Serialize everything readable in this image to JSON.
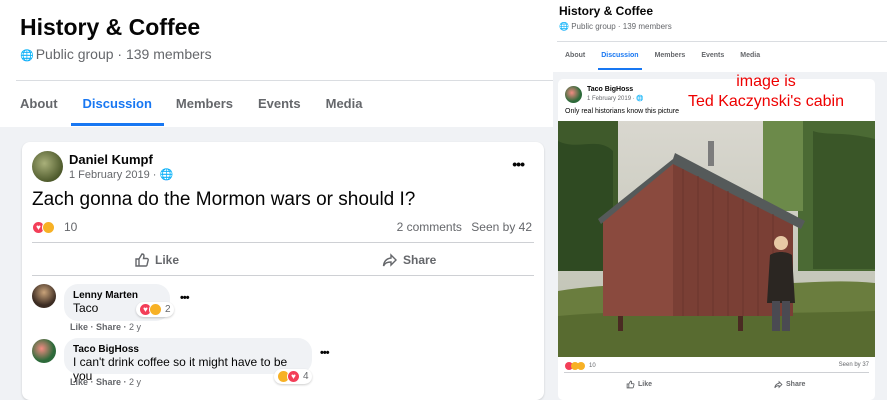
{
  "group": {
    "title": "History & Coffee",
    "meta": "Public group · 139 members",
    "tabs": [
      "About",
      "Discussion",
      "Members",
      "Events",
      "Media"
    ],
    "active_tab": "Discussion"
  },
  "post": {
    "author": "Daniel Kumpf",
    "date": "1 February 2019 · ",
    "text": "Zach gonna do the Mormon wars or should I?",
    "reaction_count": "10",
    "comments": "2 comments",
    "seen": "Seen by 42",
    "like_label": "Like",
    "share_label": "Share"
  },
  "comments": [
    {
      "name": "Lenny Marten",
      "text": "Taco",
      "reactions": "2",
      "like": "Like",
      "share": "Share",
      "time": "2 y"
    },
    {
      "name": "Taco BigHoss",
      "text": "I can't drink coffee so it might have to be you",
      "reactions": "4",
      "like": "Like",
      "share": "Share",
      "time": "2 y"
    }
  ],
  "screenshot": {
    "title": "History & Coffee",
    "meta": "Public group · 139 members",
    "tabs": [
      "About",
      "Discussion",
      "Members",
      "Events",
      "Media"
    ],
    "author": "Taco BigHoss",
    "date": "1 February 2019 · ",
    "text": "Only real historians know this picture",
    "overlay_line1": "image is",
    "overlay_line2": "Ted Kaczynski's cabin",
    "reaction_count": "10",
    "seen": "Seen by 37",
    "like_label": "Like",
    "share_label": "Share"
  },
  "colors": {
    "accent": "#1877f2",
    "overlay": "#ee0000",
    "cabin": "#8a4a3e"
  },
  "icons": {
    "globe": "globe-icon",
    "like": "thumbs-up-icon",
    "share": "share-arrow-icon",
    "more": "more-dots-icon"
  }
}
